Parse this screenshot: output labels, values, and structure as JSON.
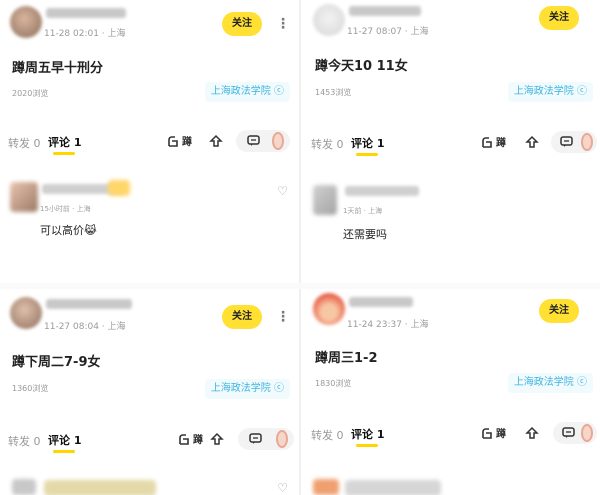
{
  "posts": [
    {
      "time_location": "11-28 02:01 · 上海",
      "follow_label": "关注",
      "content": "蹲周五早十刑分",
      "views": "2020浏览",
      "school_tag": "上海政法学院",
      "repost_label": "转发 0",
      "comment_tab_label": "评论 1",
      "squat_label": "蹲",
      "comment": {
        "time_location": "15小时前 · 上海",
        "text": "可以高价",
        "emoji": "😹"
      }
    },
    {
      "time_location": "11-27 08:07 · 上海",
      "follow_label": "关注",
      "content": "蹲今天10 11女",
      "views": "1453浏览",
      "school_tag": "上海政法学院",
      "repost_label": "转发 0",
      "comment_tab_label": "评论 1",
      "squat_label": "蹲",
      "comment": {
        "time_location": "1天前 · 上海",
        "text": "还需要吗"
      }
    },
    {
      "time_location": "11-27 08:04 · 上海",
      "follow_label": "关注",
      "content": "蹲下周二7-9女",
      "views": "1360浏览",
      "school_tag": "上海政法学院",
      "repost_label": "转发 0",
      "comment_tab_label": "评论 1",
      "squat_label": "蹲"
    },
    {
      "time_location": "11-24 23:37 · 上海",
      "follow_label": "关注",
      "content": "蹲周三1-2",
      "views": "1830浏览",
      "school_tag": "上海政法学院",
      "repost_label": "转发 0",
      "comment_tab_label": "评论 1",
      "squat_label": "蹲"
    }
  ],
  "icons": {
    "more": "more-vertical-icon",
    "squat": "squat-hand-icon",
    "share": "share-up-arrow-icon",
    "comment": "comment-bubble-icon",
    "heart": "heart-outline-icon",
    "location_pin": "location-pin-icon"
  },
  "colors": {
    "follow_button": "#ffe033",
    "school_tag_text": "#3cb3e0",
    "school_tag_bg": "#f1fbfe",
    "tab_underline": "#ffd600"
  }
}
